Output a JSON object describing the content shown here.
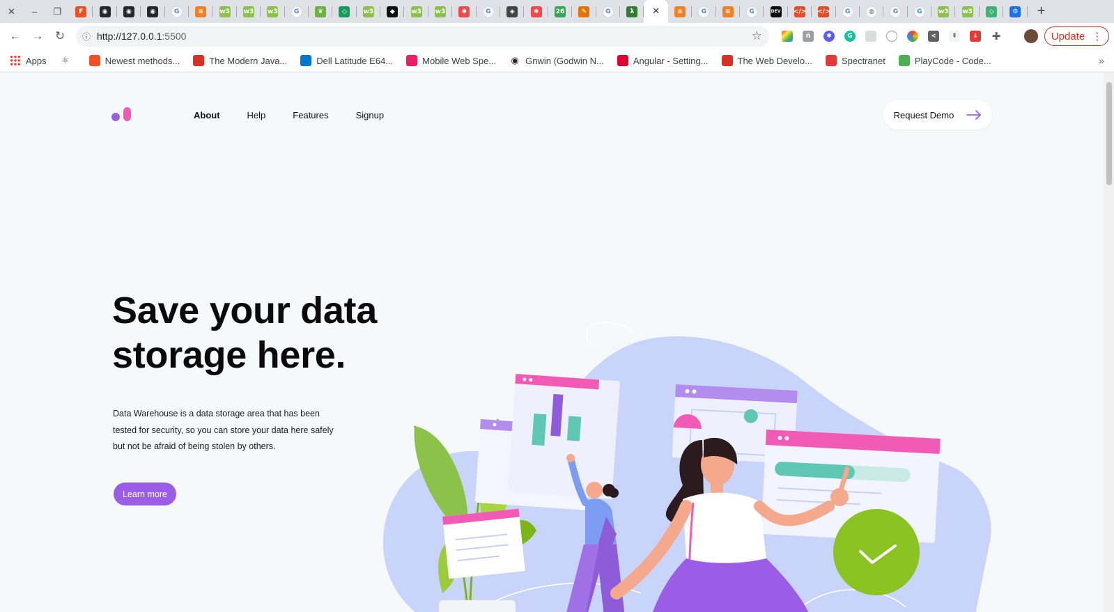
{
  "browser": {
    "tab_favicons": [
      {
        "icon": "figma-icon",
        "color": "#f24e1e"
      },
      {
        "icon": "github-icon",
        "color": "#24292e"
      },
      {
        "icon": "github-icon",
        "color": "#24292e"
      },
      {
        "icon": "github-icon",
        "color": "#24292e"
      },
      {
        "icon": "google-icon",
        "color": "#4285f4"
      },
      {
        "icon": "stackoverflow-icon",
        "color": "#f48024"
      },
      {
        "icon": "w3schools-icon",
        "color": "#8bc34a"
      },
      {
        "icon": "w3schools-icon",
        "color": "#8bc34a"
      },
      {
        "icon": "w3schools-icon",
        "color": "#8bc34a"
      },
      {
        "icon": "google-icon",
        "color": "#4285f4"
      },
      {
        "icon": "leaf-icon",
        "color": "#6db33f"
      },
      {
        "icon": "code-icon",
        "color": "#1b9a59"
      },
      {
        "icon": "w3schools-icon",
        "color": "#8bc34a"
      },
      {
        "icon": "dark-app-icon",
        "color": "#111111"
      },
      {
        "icon": "w3schools-icon",
        "color": "#8bc34a"
      },
      {
        "icon": "w3schools-icon",
        "color": "#8bc34a"
      },
      {
        "icon": "asterisk-icon",
        "color": "#ef4a4a"
      },
      {
        "icon": "google-icon",
        "color": "#4285f4"
      },
      {
        "icon": "codepen-icon",
        "color": "#444444"
      },
      {
        "icon": "asterisk-icon",
        "color": "#ef4a4a"
      },
      {
        "icon": "counter-icon",
        "color": "#34a853"
      },
      {
        "icon": "pen-icon",
        "color": "#e37400"
      },
      {
        "icon": "google-icon",
        "color": "#4285f4"
      },
      {
        "icon": "lambda-icon",
        "color": "#2e7d32"
      },
      {
        "icon": "close-icon",
        "color": "#3c4043"
      },
      {
        "icon": "stackoverflow-icon",
        "color": "#f48024"
      },
      {
        "icon": "google-icon",
        "color": "#4285f4"
      },
      {
        "icon": "stackoverflow-icon",
        "color": "#f48024"
      },
      {
        "icon": "google-icon",
        "color": "#4285f4"
      },
      {
        "icon": "dev-icon",
        "color": "#0a0a0a"
      },
      {
        "icon": "html-icon",
        "color": "#e44d26"
      },
      {
        "icon": "html-icon",
        "color": "#e44d26"
      },
      {
        "icon": "google-icon",
        "color": "#4285f4"
      },
      {
        "icon": "globe-icon",
        "color": "#5f6368"
      },
      {
        "icon": "google-icon",
        "color": "#4285f4"
      },
      {
        "icon": "google-icon",
        "color": "#4285f4"
      },
      {
        "icon": "w3schools-icon",
        "color": "#8bc34a"
      },
      {
        "icon": "w3schools-icon",
        "color": "#8bc34a"
      },
      {
        "icon": "code-icon",
        "color": "#3cb371"
      },
      {
        "icon": "settings-icon",
        "color": "#1a73e8"
      }
    ],
    "url_host": "http://127.0.0.1",
    "url_port": ":5500",
    "update_label": "Update",
    "bookmarks": [
      {
        "label": "Apps",
        "icon": "apps-grid-icon",
        "color": "#ea4335"
      },
      {
        "label": "",
        "icon": "react-icon",
        "color": "#5f6368"
      },
      {
        "label": "Newest methods...",
        "icon": "windows-icon",
        "color": "#f25022"
      },
      {
        "label": "The Modern Java...",
        "icon": "person-icon",
        "color": "#d93025"
      },
      {
        "label": "Dell Latitude E64...",
        "icon": "dell-icon",
        "color": "#0076ce"
      },
      {
        "label": "Mobile Web Spe...",
        "icon": "mobile-web-icon",
        "color": "#e91e63"
      },
      {
        "label": "Gnwin (Godwin N...",
        "icon": "github-icon",
        "color": "#24292e"
      },
      {
        "label": "Angular - Setting...",
        "icon": "angular-icon",
        "color": "#dd0031"
      },
      {
        "label": "The Web Develo...",
        "icon": "wd-icon",
        "color": "#d93025"
      },
      {
        "label": "Spectranet",
        "icon": "spectranet-icon",
        "color": "#e53935"
      },
      {
        "label": "PlayCode - Code...",
        "icon": "playcode-icon",
        "color": "#4caf50"
      }
    ]
  },
  "page": {
    "nav": [
      {
        "label": "About",
        "active": true
      },
      {
        "label": "Help",
        "active": false
      },
      {
        "label": "Features",
        "active": false
      },
      {
        "label": "Signup",
        "active": false
      }
    ],
    "request_demo_label": "Request Demo",
    "hero_title": "Save your data storage here.",
    "hero_text": "Data Warehouse is a data storage area that has been tested for security, so you can store your data here safely but not be afraid of being stolen by others.",
    "learn_more_label": "Learn more",
    "colors": {
      "accent": "#9b5de5",
      "pink": "#f15bb5",
      "teal": "#5ec8b5",
      "green": "#8bc320",
      "blob": "#c7d2fe"
    }
  }
}
